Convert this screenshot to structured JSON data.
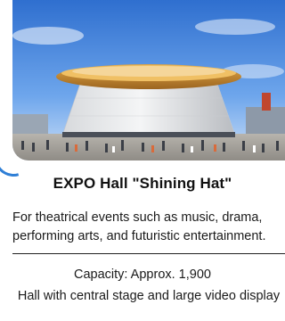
{
  "card": {
    "title": "EXPO Hall \"Shining Hat\"",
    "description": "For theatrical events such as music, drama, performing arts, and futuristic entertainment.",
    "capacity": "Capacity: Approx. 1,900",
    "feature": "Hall with central stage and large video display"
  },
  "colors": {
    "accent_blue": "#2f7fd6",
    "text": "#1a1a1a",
    "roof_gold": "#c98a2a",
    "sky": "#4f8fe0"
  },
  "image": {
    "subject": "expo-hall-rendering"
  }
}
